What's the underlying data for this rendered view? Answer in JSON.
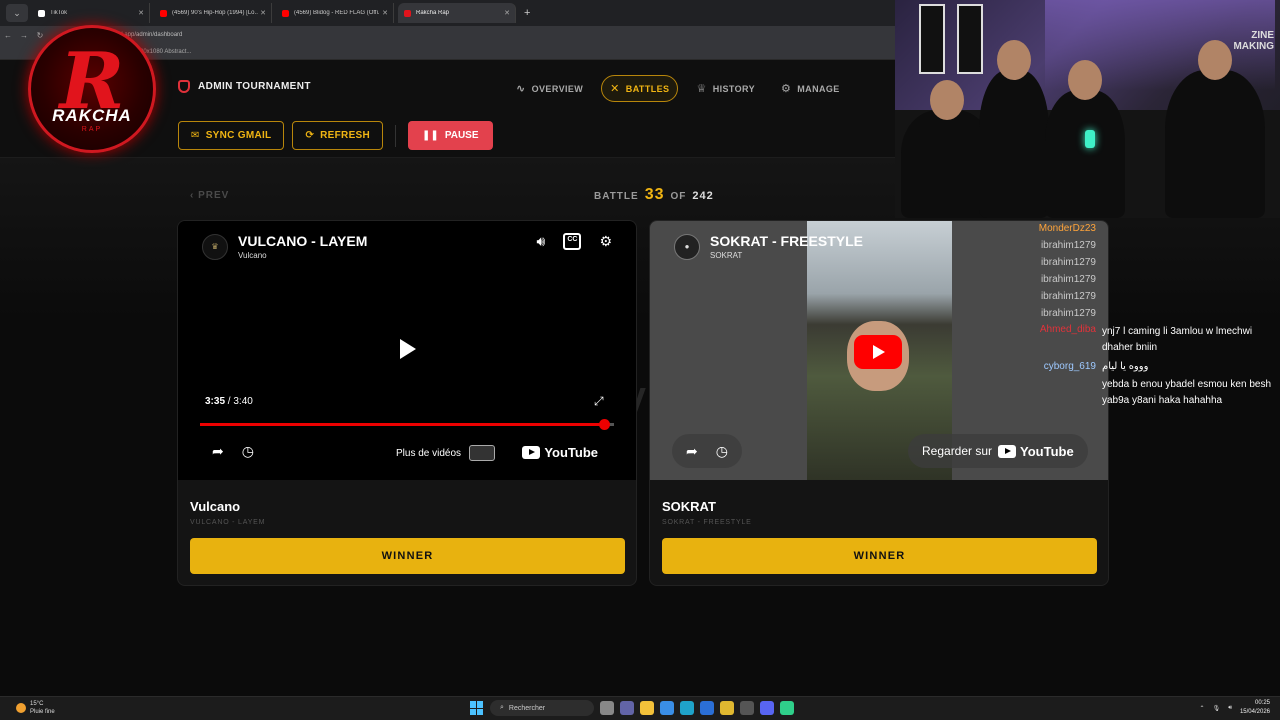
{
  "browser": {
    "tabs": [
      {
        "label": "TikTok",
        "fav_color": "#ffffff"
      },
      {
        "label": "(4569) 90's Hip-Hop (1994) [Lo...",
        "fav_color": "#ff0000"
      },
      {
        "label": "(4569) Blidog - RED FLAG (Offi...",
        "fav_color": "#ff0000"
      },
      {
        "label": "Rakcha Rap",
        "fav_color": "#e1141c"
      }
    ],
    "url": "el.app/admin/dashboard",
    "bookmark": "20x1080 Abstract..."
  },
  "app": {
    "brand_title": "ADMIN TOURNAMENT",
    "nav": [
      {
        "label": "OVERVIEW",
        "icon": "activity-icon",
        "glyph": "∿"
      },
      {
        "label": "BATTLES",
        "icon": "swords-icon",
        "glyph": "✕"
      },
      {
        "label": "HISTORY",
        "icon": "trophy-icon",
        "glyph": "♕"
      },
      {
        "label": "MANAGE",
        "icon": "gear-icon",
        "glyph": "⚙"
      }
    ],
    "actions": {
      "sync": "SYNC GMAIL",
      "refresh": "REFRESH",
      "pause": "PAUSE"
    },
    "prev": "‹ PREV",
    "battle": {
      "label": "BATTLE",
      "current": "33",
      "of": "OF",
      "total": "242"
    },
    "vs": "VS",
    "accent": "#e8b20f",
    "danger": "#e3414d"
  },
  "cards": {
    "left": {
      "video_title": "VULCANO - LAYEM",
      "channel": "Vulcano",
      "time_current": "3:35",
      "time_total": "3:40",
      "progress_fraction": 0.976,
      "more_videos": "Plus de vidéos",
      "youtube": "YouTube",
      "artist": "Vulcano",
      "artist_sub": "VULCANO - LAYEM",
      "winner": "WINNER"
    },
    "right": {
      "video_title": "SOKRAT - FREESTYLE",
      "channel": "SOKRAT",
      "watch_on": "Regarder sur",
      "youtube": "YouTube",
      "artist": "SOKRAT",
      "artist_sub": "SOKRAT - FREESTYLE",
      "winner": "WINNER"
    }
  },
  "logo": {
    "letter": "R",
    "text": "RAKCHA",
    "sub": "RAP"
  },
  "webcam": {
    "sign": "ZINE\nMAKING"
  },
  "chat": [
    {
      "user": "MonderDz23",
      "color": "orange",
      "msg": ""
    },
    {
      "user": "ibrahim1279",
      "color": "gray",
      "msg": ""
    },
    {
      "user": "ibrahim1279",
      "color": "gray",
      "msg": ""
    },
    {
      "user": "ibrahim1279",
      "color": "gray",
      "msg": ""
    },
    {
      "user": "ibrahim1279",
      "color": "gray",
      "msg": ""
    },
    {
      "user": "ibrahim1279",
      "color": "gray",
      "msg": ""
    },
    {
      "user": "Ahmed_diba",
      "color": "red",
      "msg": "ynj7 l caming li 3amlou w lmechwi dhaher bniin"
    },
    {
      "user": "cyborg_619",
      "color": "blue",
      "msg": "وووه يا ليام"
    },
    {
      "user": "",
      "color": "purple",
      "msg": "yebda b enou ybadel esmou ken besh yab9a y8ani haka hahahha"
    }
  ],
  "taskbar": {
    "temp": "15°C",
    "weather": "Pluie fine",
    "search": "Rechercher",
    "time": "00:25",
    "date": "15/04/2026"
  }
}
